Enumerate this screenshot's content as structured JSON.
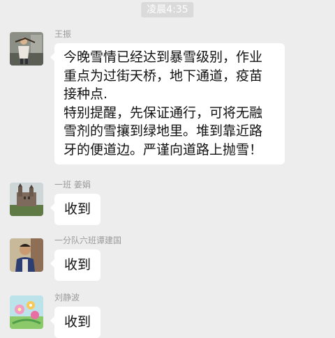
{
  "chat": {
    "timestamp": "凌晨4:35",
    "messages": [
      {
        "sender": "王振",
        "avatar_icon": "person-outdoor-avatar-icon",
        "paragraphs": [
          "今晚雪情已经达到暴雪级别，作业\n重点为过街天桥，地下通道，疫苗\n接种点.",
          "特别提醒，先保证通行，可将无融\n雪剂的雪攘到绿地里。堆到靠近路\n牙的便道边。严谨向道路上抛雪！"
        ]
      },
      {
        "sender": "一班 姜娟",
        "avatar_icon": "castle-landscape-avatar-icon",
        "paragraphs": [
          "收到"
        ]
      },
      {
        "sender": "一分队六班谭建国",
        "avatar_icon": "person-portrait-avatar-icon",
        "paragraphs": [
          "收到"
        ]
      },
      {
        "sender": "刘静波",
        "avatar_icon": "flower-illustration-avatar-icon",
        "paragraphs": [
          "收到"
        ]
      }
    ]
  }
}
